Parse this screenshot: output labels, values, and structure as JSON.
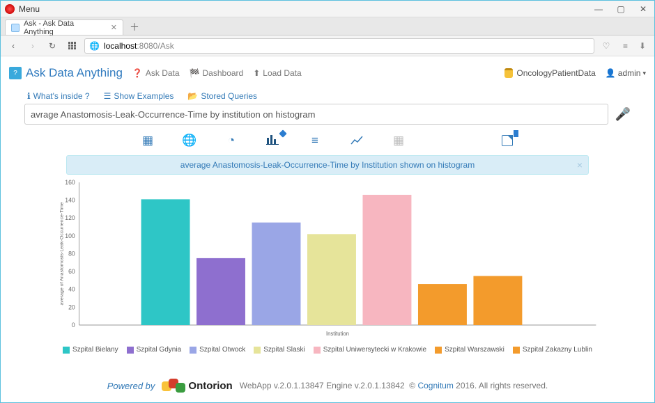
{
  "window": {
    "menu_label": "Menu",
    "tab_title": "Ask - Ask Data Anything",
    "min": "—",
    "max": "▢",
    "close": "✕"
  },
  "browser": {
    "host": "localhost",
    "port_path": ":8080/Ask"
  },
  "app_nav": {
    "brand": "Ask Data Anything",
    "ask_data": "Ask Data",
    "dashboard": "Dashboard",
    "load_data": "Load Data",
    "datasource": "OncologyPatientData",
    "user": "admin"
  },
  "help_links": {
    "whats_inside": "What's inside ?",
    "show_examples": "Show Examples",
    "stored_queries": "Stored Queries"
  },
  "query": {
    "value": "avrage Anastomosis-Leak-Occurrence-Time by institution on histogram"
  },
  "banner": {
    "text": "average Anastomosis-Leak-Occurrence-Time by Institution shown on histogram",
    "close": "×"
  },
  "chart_data": {
    "type": "bar",
    "title": "",
    "xlabel": "Institution",
    "ylabel": "average of Anastomosis-Leak-Occurrence-Time",
    "ylim": [
      0,
      160
    ],
    "yticks": [
      0,
      20,
      40,
      60,
      80,
      100,
      120,
      140,
      160
    ],
    "categories": [
      "Szpital Bielany",
      "Szpital Gdynia",
      "Szpital Otwock",
      "Szpital Slaski",
      "Szpital Uniwersytecki w Krakowie",
      "Szpital Warszawski",
      "Szpital Zakazny Lublin"
    ],
    "values": [
      141,
      75,
      115,
      102,
      146,
      46,
      55
    ],
    "colors": [
      "#2ec6c6",
      "#8e6fcf",
      "#9aa6e6",
      "#e6e49a",
      "#f7b6c0",
      "#f39b2c",
      "#f39b2c"
    ]
  },
  "footer": {
    "powered_by": "Powered by",
    "brand": "Ontorion",
    "webapp_prefix": "WebApp v.",
    "webapp_ver": "2.0.1.13847",
    "engine_prefix": " Engine v.",
    "engine_ver": "2.0.1.13842",
    "copyright_link": "Cognitum",
    "copyright_rest": " 2016. All rights reserved."
  }
}
